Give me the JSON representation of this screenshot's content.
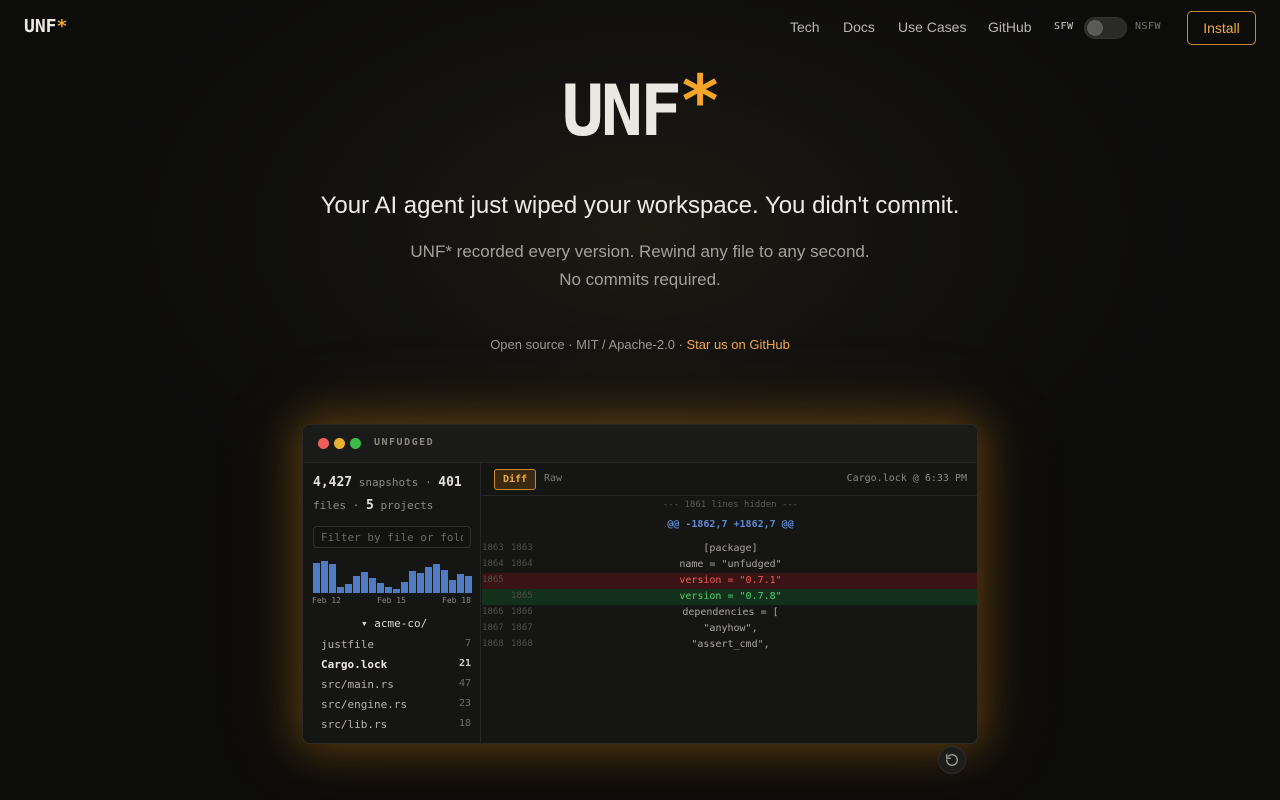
{
  "nav": {
    "logo_text": "UNF",
    "logo_star": "*",
    "links": [
      "Tech",
      "Docs",
      "Use Cases",
      "GitHub"
    ],
    "toggle_left": "SFW",
    "toggle_right": "NSFW",
    "install_label": "Install"
  },
  "hero": {
    "title_text": "UNF",
    "title_star": "*",
    "headline": "Your AI agent just wiped your workspace. You didn't commit.",
    "sub_line1": "UNF* recorded every version. Rewind any file to any second.",
    "sub_line2": "No commits required.",
    "license_text": "Open source · MIT / Apache-2.0 · ",
    "star_link": "Star us on GitHub"
  },
  "app": {
    "window_title": "UNFUDGED",
    "stats": {
      "snapshots_count": "4,427",
      "snapshots_label": "snapshots",
      "files_count": "401",
      "files_label": "files",
      "projects_count": "5",
      "projects_label": "projects"
    },
    "filter_placeholder": "Filter by file or folder",
    "histogram": {
      "values": [
        28,
        30,
        27,
        6,
        8,
        16,
        20,
        14,
        9,
        6,
        4,
        10,
        21,
        19,
        24,
        27,
        22,
        12,
        18,
        16
      ],
      "dates": [
        "Feb 12",
        "Feb 15",
        "Feb 18"
      ]
    },
    "folder": "▾ acme-co/",
    "files": [
      {
        "name": "justfile",
        "count": "7"
      },
      {
        "name": "Cargo.lock",
        "count": "21"
      },
      {
        "name": "src/main.rs",
        "count": "47"
      },
      {
        "name": "src/engine.rs",
        "count": "23"
      },
      {
        "name": "src/lib.rs",
        "count": "18"
      }
    ],
    "tab_diff": "Diff",
    "tab_raw": "Raw",
    "file_meta": "Cargo.lock @ 6:33 PM",
    "hidden_note": "--- 1861 lines hidden ---",
    "hunk_header": "@@ -1862,7 +1862,7 @@",
    "diff_lines": [
      {
        "old": "1863",
        "new": "1863",
        "code": "[package]",
        "kind": "ctx"
      },
      {
        "old": "1864",
        "new": "1864",
        "code": "name = \"unfudged\"",
        "kind": "ctx"
      },
      {
        "old": "1865",
        "new": "",
        "code": "version = \"0.7.1\"",
        "kind": "del"
      },
      {
        "old": "",
        "new": "1865",
        "code": "version = \"0.7.8\"",
        "kind": "add"
      },
      {
        "old": "1866",
        "new": "1866",
        "code": "dependencies = [",
        "kind": "ctx"
      },
      {
        "old": "1867",
        "new": "1867",
        "code": "\"anyhow\",",
        "kind": "ctx"
      },
      {
        "old": "1868",
        "new": "1868",
        "code": "\"assert_cmd\",",
        "kind": "ctx"
      }
    ]
  },
  "colors": {
    "accent": "#f0a940",
    "bar": "#4e7bc4",
    "del": "#ef5a55",
    "add": "#4fd06d"
  },
  "icons": {
    "rewind": "rotate-ccw-icon"
  }
}
